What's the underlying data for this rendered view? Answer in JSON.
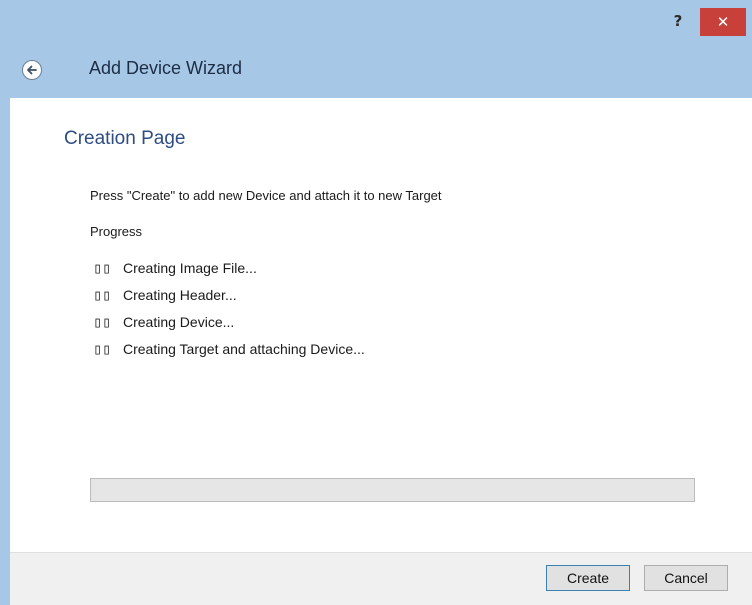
{
  "titlebar": {
    "help_label": "?",
    "close_label": "✕"
  },
  "header": {
    "title": "Add Device Wizard",
    "back_icon": "back-arrow-icon"
  },
  "page": {
    "title": "Creation Page",
    "instruction": "Press \"Create\" to add new Device and attach it to new Target",
    "progress_label": "Progress"
  },
  "steps": [
    {
      "icon": "▯▯",
      "label": "Creating Image File..."
    },
    {
      "icon": "▯▯",
      "label": "Creating Header..."
    },
    {
      "icon": "▯▯",
      "label": "Creating Device..."
    },
    {
      "icon": "▯▯",
      "label": "Creating Target and attaching Device..."
    }
  ],
  "progress": {
    "value": 0
  },
  "footer": {
    "create_label": "Create",
    "cancel_label": "Cancel"
  },
  "colors": {
    "window_frame": "#a7c7e6",
    "close_button": "#c7403a",
    "page_title": "#2d4d84"
  }
}
